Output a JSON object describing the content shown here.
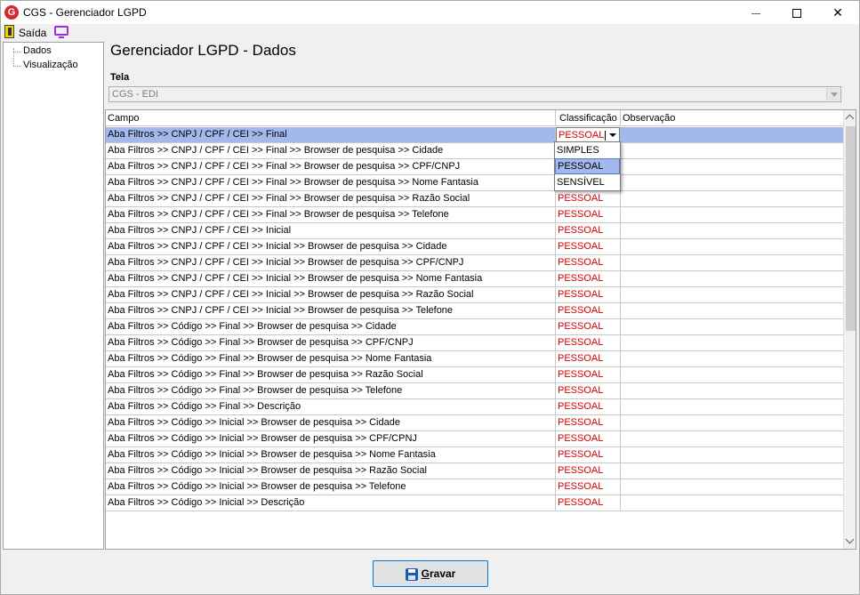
{
  "window": {
    "title": "CGS - Gerenciador LGPD",
    "app_icon": "cgs-logo-icon",
    "app_icon_letter": "G"
  },
  "menu": {
    "exit_label": "Saída",
    "exit_icon": "exit-door-icon",
    "monitor_icon": "monitor-icon"
  },
  "tree": {
    "items": [
      {
        "label": "Dados"
      },
      {
        "label": "Visualização"
      }
    ]
  },
  "main": {
    "title": "Gerenciador LGPD - Dados",
    "tela_label": "Tela",
    "tela_value": "CGS - EDI"
  },
  "grid": {
    "columns": [
      "Campo",
      "Classificação",
      "Observação"
    ],
    "rows": [
      {
        "campo": "Aba Filtros >> CNPJ / CPF / CEI >> Final",
        "classificacao": "PESSOAL",
        "observacao": ""
      },
      {
        "campo": "Aba Filtros >> CNPJ / CPF / CEI >> Final >> Browser de pesquisa >> Cidade",
        "classificacao": "",
        "observacao": ""
      },
      {
        "campo": "Aba Filtros >> CNPJ / CPF / CEI >> Final >> Browser de pesquisa >> CPF/CNPJ",
        "classificacao": "",
        "observacao": ""
      },
      {
        "campo": "Aba Filtros >> CNPJ / CPF / CEI >> Final >> Browser de pesquisa >> Nome Fantasia",
        "classificacao": "",
        "observacao": ""
      },
      {
        "campo": "Aba Filtros >> CNPJ / CPF / CEI >> Final >> Browser de pesquisa >> Razão Social",
        "classificacao": "PESSOAL",
        "observacao": ""
      },
      {
        "campo": "Aba Filtros >> CNPJ / CPF / CEI >> Final >> Browser de pesquisa >> Telefone",
        "classificacao": "PESSOAL",
        "observacao": ""
      },
      {
        "campo": "Aba Filtros >> CNPJ / CPF / CEI >> Inicial",
        "classificacao": "PESSOAL",
        "observacao": ""
      },
      {
        "campo": "Aba Filtros >> CNPJ / CPF / CEI >> Inicial >> Browser de pesquisa >> Cidade",
        "classificacao": "PESSOAL",
        "observacao": ""
      },
      {
        "campo": "Aba Filtros >> CNPJ / CPF / CEI >> Inicial >> Browser de pesquisa >> CPF/CNPJ",
        "classificacao": "PESSOAL",
        "observacao": ""
      },
      {
        "campo": "Aba Filtros >> CNPJ / CPF / CEI >> Inicial >> Browser de pesquisa >> Nome Fantasia",
        "classificacao": "PESSOAL",
        "observacao": ""
      },
      {
        "campo": "Aba Filtros >> CNPJ / CPF / CEI >> Inicial >> Browser de pesquisa >> Razão Social",
        "classificacao": "PESSOAL",
        "observacao": ""
      },
      {
        "campo": "Aba Filtros >> CNPJ / CPF / CEI >> Inicial >> Browser de pesquisa >> Telefone",
        "classificacao": "PESSOAL",
        "observacao": ""
      },
      {
        "campo": "Aba Filtros >> Código >> Final >> Browser de pesquisa >> Cidade",
        "classificacao": "PESSOAL",
        "observacao": ""
      },
      {
        "campo": "Aba Filtros >> Código >> Final >> Browser de pesquisa >> CPF/CNPJ",
        "classificacao": "PESSOAL",
        "observacao": ""
      },
      {
        "campo": "Aba Filtros >> Código >> Final >> Browser de pesquisa >> Nome Fantasia",
        "classificacao": "PESSOAL",
        "observacao": ""
      },
      {
        "campo": "Aba Filtros >> Código >> Final >> Browser de pesquisa >> Razão Social",
        "classificacao": "PESSOAL",
        "observacao": ""
      },
      {
        "campo": "Aba Filtros >> Código >> Final >> Browser de pesquisa >> Telefone",
        "classificacao": "PESSOAL",
        "observacao": ""
      },
      {
        "campo": "Aba Filtros >> Código >> Final >> Descrição",
        "classificacao": "PESSOAL",
        "observacao": ""
      },
      {
        "campo": "Aba Filtros >> Código >> Inicial >> Browser de pesquisa >> Cidade",
        "classificacao": "PESSOAL",
        "observacao": ""
      },
      {
        "campo": "Aba Filtros >> Código >> Inicial >> Browser de pesquisa >> CPF/CPNJ",
        "classificacao": "PESSOAL",
        "observacao": ""
      },
      {
        "campo": "Aba Filtros >> Código >> Inicial >> Browser de pesquisa >> Nome Fantasia",
        "classificacao": "PESSOAL",
        "observacao": ""
      },
      {
        "campo": "Aba Filtros >> Código >> Inicial >> Browser de pesquisa >> Razão Social",
        "classificacao": "PESSOAL",
        "observacao": ""
      },
      {
        "campo": "Aba Filtros >> Código >> Inicial >> Browser de pesquisa >> Telefone",
        "classificacao": "PESSOAL",
        "observacao": ""
      },
      {
        "campo": "Aba Filtros >> Código >> Inicial >> Descrição",
        "classificacao": "PESSOAL",
        "observacao": ""
      }
    ],
    "dropdown_options": [
      "SIMPLES",
      "PESSOAL",
      "SENSÍVEL"
    ],
    "dropdown_highlighted": "PESSOAL",
    "colors": {
      "selected_row": "#a3b9ec",
      "classification_text": "#d40000"
    }
  },
  "footer": {
    "save_label_first": "G",
    "save_label_rest": "ravar",
    "save_icon": "floppy-disk-icon"
  }
}
